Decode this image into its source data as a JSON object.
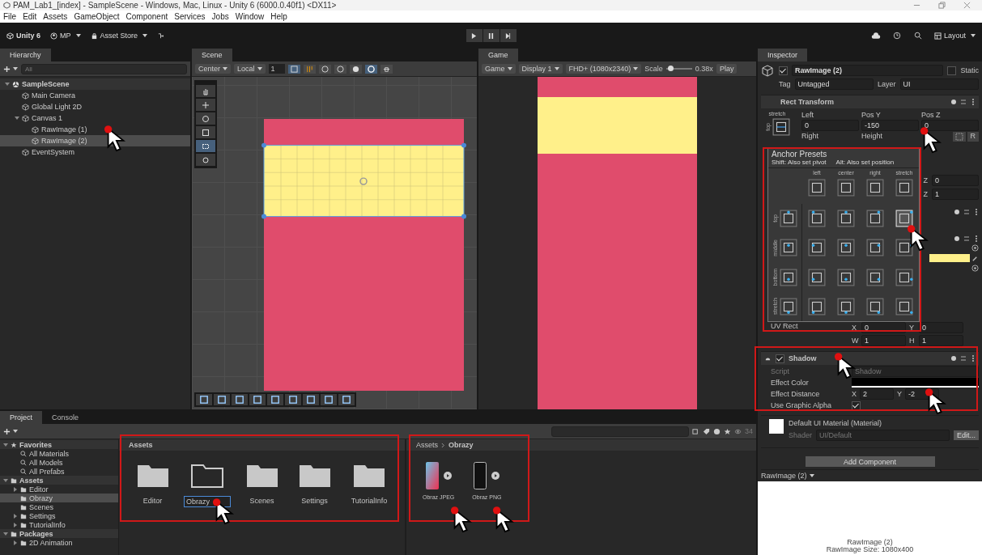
{
  "window": {
    "title": "PAM_Lab1_[index] - SampleScene - Windows, Mac, Linux - Unity 6 (6000.0.40f1) <DX11>"
  },
  "menu": [
    "File",
    "Edit",
    "Assets",
    "GameObject",
    "Component",
    "Services",
    "Jobs",
    "Window",
    "Help"
  ],
  "toolbar": {
    "account": "Unity 6",
    "user": "MP",
    "store": "Asset Store",
    "layout": "Layout",
    "playing": false,
    "paused": false
  },
  "hierarchy": {
    "tab": "Hierarchy",
    "search_placeholder": "All",
    "tree": [
      {
        "label": "SampleScene",
        "kind": "scene",
        "expanded": true,
        "selected": false,
        "children": [
          {
            "label": "Main Camera",
            "kind": "object",
            "selected": false
          },
          {
            "label": "Global Light 2D",
            "kind": "object",
            "selected": false
          },
          {
            "label": "Canvas 1",
            "kind": "object",
            "expanded": true,
            "selected": false,
            "children": [
              {
                "label": "RawImage (1)",
                "kind": "object",
                "selected": false
              },
              {
                "label": "RawImage (2)",
                "kind": "object",
                "selected": true
              }
            ]
          },
          {
            "label": "EventSystem",
            "kind": "object",
            "selected": false
          }
        ]
      }
    ]
  },
  "scene": {
    "tab": "Scene",
    "pivot": "Center",
    "space": "Local",
    "grid_size": "1",
    "toggles": [
      {
        "kind": "grid",
        "on": true
      },
      {
        "kind": "snap",
        "on": false
      },
      {
        "kind": "gizmo",
        "on": false
      },
      {
        "kind": "half",
        "on": false
      },
      {
        "kind": "dot",
        "on": false
      },
      {
        "kind": "moon",
        "on": true
      },
      {
        "kind": "bug",
        "on": false
      }
    ],
    "tools": [
      {
        "kind": "hand",
        "selected": false
      },
      {
        "kind": "move",
        "selected": false
      },
      {
        "kind": "rotate",
        "selected": false
      },
      {
        "kind": "scale",
        "selected": false
      },
      {
        "kind": "rect",
        "selected": true
      },
      {
        "kind": "transform",
        "selected": false
      }
    ]
  },
  "game": {
    "tab": "Game",
    "mode": "Game",
    "display": "Display 1",
    "resolution": "FHD+ (1080x2340)",
    "scale_label": "Scale",
    "scale": {
      "level": 0.15
    },
    "scale_value": "0.38x",
    "play": "Play"
  },
  "inspector": {
    "tab": "Inspector",
    "object_name": "RawImage (2)",
    "active": true,
    "static": false,
    "static_label": "Static",
    "tag_label": "Tag",
    "tag": "Untagged",
    "layer_label": "Layer",
    "layer": "UI",
    "rect_transform": {
      "title": "Rect Transform",
      "anchor_label": "stretch",
      "side_label": "top",
      "fields": [
        {
          "label": "Left",
          "value": "0"
        },
        {
          "label": "Pos Y",
          "value": "-150"
        },
        {
          "label": "Pos Z",
          "value": "0"
        }
      ],
      "labels2": [
        "Right",
        "Height"
      ],
      "raw_button": "R"
    },
    "anchor_presets": {
      "title": "Anchor Presets",
      "hint_shift": "Shift: Also set pivot",
      "hint_alt": "Alt: Also set position",
      "columns": [
        "left",
        "center",
        "right",
        "stretch"
      ],
      "rows": [
        {
          "label": "top",
          "presets": [
            {
              "selected": false
            },
            {
              "selected": false
            },
            {
              "selected": false
            },
            {
              "selected": false
            },
            {
              "selected": true
            }
          ]
        },
        {
          "label": "middle",
          "presets": [
            {
              "selected": false
            },
            {
              "selected": false
            },
            {
              "selected": false
            },
            {
              "selected": false
            },
            {
              "selected": false
            }
          ]
        },
        {
          "label": "bottom",
          "presets": [
            {
              "selected": false
            },
            {
              "selected": false
            },
            {
              "selected": false
            },
            {
              "selected": false
            },
            {
              "selected": false
            }
          ]
        },
        {
          "label": "stretch",
          "presets": [
            {
              "selected": false
            },
            {
              "selected": false
            },
            {
              "selected": false
            },
            {
              "selected": false
            },
            {
              "selected": false
            }
          ]
        }
      ]
    },
    "partial_fields": [
      {
        "label": "Z",
        "value": "0"
      },
      {
        "label": "Z",
        "value": "1"
      }
    ],
    "uv_rect": {
      "label": "UV Rect",
      "fields": [
        {
          "label": "X",
          "value": "0"
        },
        {
          "label": "Y",
          "value": "0"
        },
        {
          "label": "W",
          "value": "1"
        },
        {
          "label": "H",
          "value": "1"
        }
      ]
    },
    "shadow": {
      "title": "Shadow",
      "enabled": true,
      "script_label": "Script",
      "script": "Shadow",
      "color_label": "Effect Color",
      "distance_label": "Effect Distance",
      "distance": [
        {
          "label": "X",
          "value": "2"
        },
        {
          "label": "Y",
          "value": "-2"
        }
      ],
      "alpha_label": "Use Graphic Alpha",
      "use_graphic_alpha": true
    },
    "material": {
      "title": "Default UI Material (Material)",
      "shader_label": "Shader",
      "shader": "UI/Default",
      "edit": "Edit..."
    },
    "add_component": "Add Component",
    "preview_title": "RawImage (2)",
    "preview_lines": [
      "RawImage (2)",
      "RawImage Size: 1080x400"
    ]
  },
  "project": {
    "tabs": [
      {
        "label": "Project",
        "selected": true
      },
      {
        "label": "Console",
        "selected": false
      }
    ],
    "count": "34",
    "tree": [
      {
        "label": "Favorites",
        "kind": "favorites",
        "expanded": true,
        "selected": false,
        "children": [
          {
            "label": "All Materials",
            "kind": "search",
            "selected": false
          },
          {
            "label": "All Models",
            "kind": "search",
            "selected": false
          },
          {
            "label": "All Prefabs",
            "kind": "search",
            "selected": false
          }
        ]
      },
      {
        "label": "Assets",
        "kind": "folder",
        "expanded": true,
        "selected": false,
        "children": [
          {
            "label": "Editor",
            "kind": "folder",
            "expanded": false,
            "selected": false
          },
          {
            "label": "Obrazy",
            "kind": "folder",
            "selected": true
          },
          {
            "label": "Scenes",
            "kind": "folder",
            "selected": false
          },
          {
            "label": "Settings",
            "kind": "folder",
            "expanded": false,
            "selected": false
          },
          {
            "label": "TutorialInfo",
            "kind": "folder",
            "expanded": false,
            "selected": false
          }
        ]
      },
      {
        "label": "Packages",
        "kind": "folder",
        "expanded": true,
        "selected": false,
        "children": [
          {
            "label": "2D Animation",
            "kind": "folder",
            "expanded": false,
            "selected": false
          }
        ]
      }
    ],
    "assets_header": "Assets",
    "assets": [
      {
        "label": "Editor",
        "renaming": false
      },
      {
        "label": "Obrazy",
        "renaming": true
      },
      {
        "label": "Scenes",
        "renaming": false
      },
      {
        "label": "Settings",
        "renaming": false
      },
      {
        "label": "TutorialInfo",
        "renaming": false
      }
    ],
    "breadcrumb": [
      "Assets",
      "Obrazy"
    ],
    "files": [
      {
        "label": "Obraz JPEG",
        "kind": "photo"
      },
      {
        "label": "Obraz PNG",
        "kind": "phone"
      }
    ]
  }
}
